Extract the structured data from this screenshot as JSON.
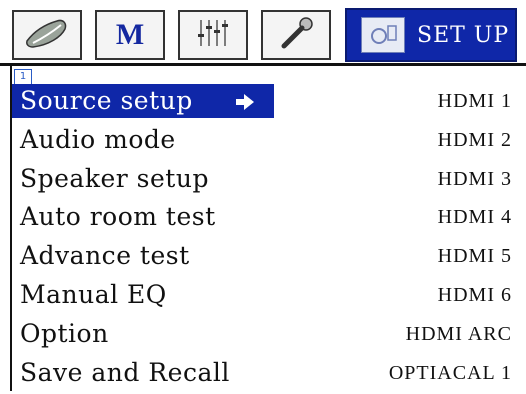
{
  "tabs": [
    {
      "name": "tab-source",
      "icon": "shoe-icon"
    },
    {
      "name": "tab-mode",
      "icon": "m-icon",
      "glyph": "M"
    },
    {
      "name": "tab-equalizer",
      "icon": "sliders-icon"
    },
    {
      "name": "tab-mic",
      "icon": "microphone-icon"
    }
  ],
  "active_tab": {
    "label": "SET UP",
    "icon": "setup-icon"
  },
  "page_number": "1",
  "menu": {
    "items": [
      {
        "label": "Source setup",
        "value": "HDMI 1",
        "selected": true
      },
      {
        "label": "Audio mode",
        "value": "HDMI 2"
      },
      {
        "label": "Speaker setup",
        "value": "HDMI 3"
      },
      {
        "label": "Auto room test",
        "value": "HDMI 4"
      },
      {
        "label": "Advance test",
        "value": "HDMI 5"
      },
      {
        "label": "Manual EQ",
        "value": "HDMI 6"
      },
      {
        "label": "Option",
        "value": "HDMI ARC"
      },
      {
        "label": "Save and Recall",
        "value": "OPTIACAL 1"
      }
    ]
  },
  "colors": {
    "highlight": "#0f27a8",
    "text": "#111111",
    "highlight_text": "#ffffff"
  }
}
